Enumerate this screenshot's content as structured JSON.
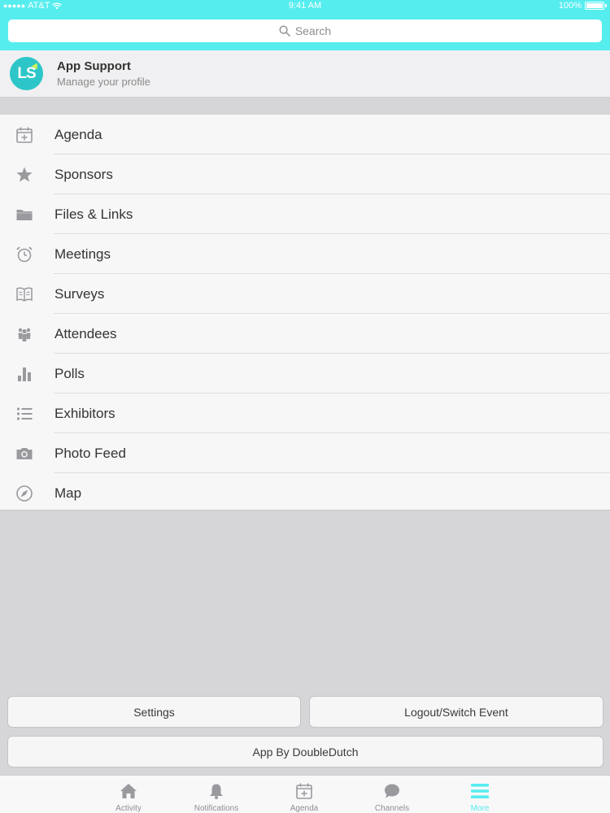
{
  "status": {
    "carrier": "AT&T",
    "time": "9:41 AM",
    "battery": "100%"
  },
  "search": {
    "placeholder": "Search"
  },
  "profile": {
    "avatar_text": "LS",
    "name": "App Support",
    "subtitle": "Manage your profile"
  },
  "menu": {
    "items": [
      {
        "label": "Agenda",
        "icon": "calendar-plus-icon"
      },
      {
        "label": "Sponsors",
        "icon": "star-icon"
      },
      {
        "label": "Files & Links",
        "icon": "folder-icon"
      },
      {
        "label": "Meetings",
        "icon": "alarm-clock-icon"
      },
      {
        "label": "Surveys",
        "icon": "open-book-icon"
      },
      {
        "label": "Attendees",
        "icon": "people-icon"
      },
      {
        "label": "Polls",
        "icon": "bar-chart-icon"
      },
      {
        "label": "Exhibitors",
        "icon": "list-icon"
      },
      {
        "label": "Photo Feed",
        "icon": "camera-icon"
      },
      {
        "label": "Map",
        "icon": "compass-icon"
      }
    ]
  },
  "buttons": {
    "settings": "Settings",
    "logout": "Logout/Switch Event",
    "app_by": "App By DoubleDutch"
  },
  "tabs": [
    {
      "label": "Activity",
      "icon": "home-icon"
    },
    {
      "label": "Notifications",
      "icon": "bell-icon"
    },
    {
      "label": "Agenda",
      "icon": "calendar-plus-icon"
    },
    {
      "label": "Channels",
      "icon": "chat-bubble-icon"
    },
    {
      "label": "More",
      "icon": "menu-lines-icon",
      "active": true
    }
  ],
  "colors": {
    "accent": "#56edef",
    "icon_gray": "#9a9a9e",
    "avatar_bg": "#2dc6c8"
  }
}
